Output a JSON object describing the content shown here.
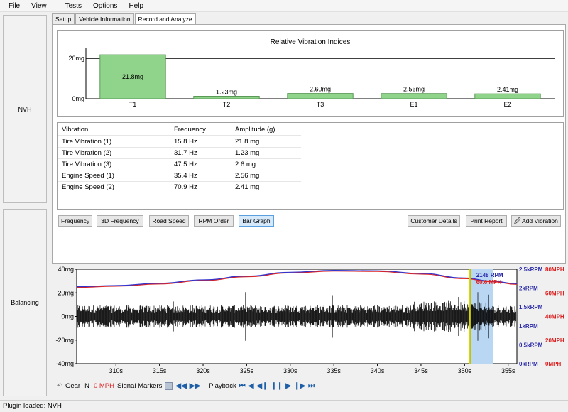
{
  "menu": [
    "File",
    "View",
    "Tests",
    "Options",
    "Help"
  ],
  "side_buttons": {
    "nvh": "NVH",
    "balancing": "Balancing"
  },
  "tabs": [
    {
      "label": "Setup",
      "active": false
    },
    {
      "label": "Vehicle Information",
      "active": false
    },
    {
      "label": "Record and Analyze",
      "active": true
    }
  ],
  "bar_chart": {
    "chart_data": {
      "type": "bar",
      "title": "Relative Vibration Indices",
      "categories": [
        "T1",
        "T2",
        "T3",
        "E1",
        "E2"
      ],
      "values": [
        21.8,
        1.23,
        2.6,
        2.56,
        2.41
      ],
      "value_labels": [
        "21.8mg",
        "1.23mg",
        "2.60mg",
        "2.56mg",
        "2.41mg"
      ],
      "y_ticks": [
        {
          "value": 0,
          "label": "0mg"
        },
        {
          "value": 20,
          "label": "20mg"
        }
      ],
      "ylim": [
        0,
        25
      ],
      "bar_color": "#8fd48a"
    }
  },
  "vibration_table": {
    "headers": [
      "Vibration",
      "Frequency",
      "Amplitude (g)"
    ],
    "rows": [
      [
        "Tire Vibration (1)",
        "15.8 Hz",
        "21.8 mg"
      ],
      [
        "Tire Vibration (2)",
        "31.7 Hz",
        "1.23 mg"
      ],
      [
        "Tire Vibration (3)",
        "47.5 Hz",
        "2.6 mg"
      ],
      [
        "Engine Speed (1)",
        "35.4 Hz",
        "2.56 mg"
      ],
      [
        "Engine Speed (2)",
        "70.9 Hz",
        "2.41 mg"
      ]
    ]
  },
  "view_buttons": [
    "Frequency",
    "3D Frequency",
    "Road Speed",
    "RPM Order",
    "Bar Graph"
  ],
  "selected_view": "Bar Graph",
  "action_buttons": {
    "customer_details": "Customer Details",
    "print_report": "Print Report",
    "add_vibration": "Add Vibration"
  },
  "time_chart": {
    "chart_data": {
      "type": "line",
      "x_range": [
        305.5,
        356.0
      ],
      "x_ticks": [
        "310s",
        "315s",
        "320s",
        "325s",
        "330s",
        "335s",
        "340s",
        "345s",
        "350s",
        "355s"
      ],
      "x_tick_values": [
        310,
        315,
        320,
        325,
        330,
        335,
        340,
        345,
        350,
        355
      ],
      "y_left_ticks": [
        "40mg",
        "20mg",
        "0mg",
        "-20mg",
        "-40mg"
      ],
      "y_left_range": [
        -40,
        40
      ],
      "y_rpm_ticks": [
        "2.5kRPM",
        "2kRPM",
        "1.5kRPM",
        "1kRPM",
        "0.5kRPM",
        "0kRPM"
      ],
      "y_rpm_range": [
        0,
        2500
      ],
      "y_mph_ticks": [
        "80MPH",
        "60MPH",
        "40MPH",
        "20MPH",
        "0MPH"
      ],
      "y_mph_range": [
        0,
        80
      ],
      "rpm_series": {
        "x": [
          305.5,
          310,
          315,
          320,
          325,
          330,
          335,
          340,
          345,
          350,
          353,
          356
        ],
        "y": [
          2020,
          2050,
          2110,
          2200,
          2300,
          2400,
          2450,
          2440,
          2370,
          2250,
          2170,
          2100
        ]
      },
      "cursor": {
        "time": 350.6,
        "rpm_label": "2148 RPM",
        "mph_label": "60.6 MPH"
      },
      "highlight_range": [
        350.6,
        353.3
      ],
      "colors": {
        "rpm": "#3333cc",
        "mph": "#dd2222",
        "cursor": "#d8d800",
        "highlight": "#b9d6f2",
        "rpm_axis": "#2a2aa8",
        "mph_axis": "#dd2222"
      }
    }
  },
  "controls": {
    "gear_label": "Gear",
    "gear_value": "N",
    "speed_value": "0 MPH",
    "signal_markers_label": "Signal Markers",
    "playback_label": "Playback"
  },
  "status": "Plugin loaded: NVH"
}
